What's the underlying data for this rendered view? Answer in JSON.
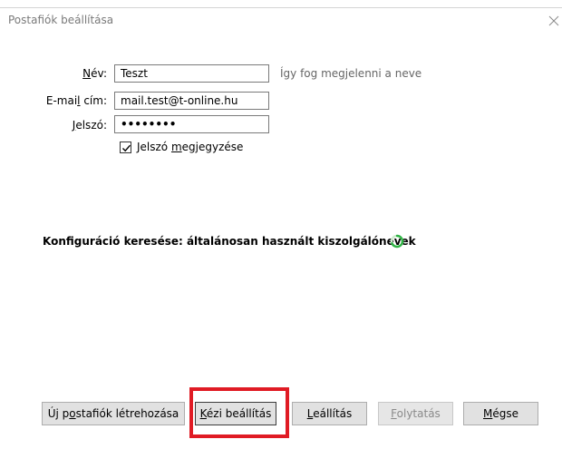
{
  "window": {
    "title": "Postafiók beállítása"
  },
  "form": {
    "name_label": "Név:",
    "name_value": "Teszt",
    "name_hint": "Így fog megjelenni a neve",
    "email_label": "E-mail cím:",
    "email_value": "mail.test@t-online.hu",
    "password_label": "Jelszó:",
    "password_value": "••••••••",
    "remember_label": "Jelszó megjegyzése",
    "remember_checked": true
  },
  "status": {
    "text": "Konfiguráció keresése: általánosan használt kiszolgálónevek"
  },
  "buttons": {
    "new_account": "Új postafiók létrehozása",
    "manual": "Kézi beállítás",
    "stop": "Leállítás",
    "continue": "Folytatás",
    "cancel": "Mégse"
  },
  "colors": {
    "highlight": "#e01b24",
    "spinner": "#2fb344"
  }
}
